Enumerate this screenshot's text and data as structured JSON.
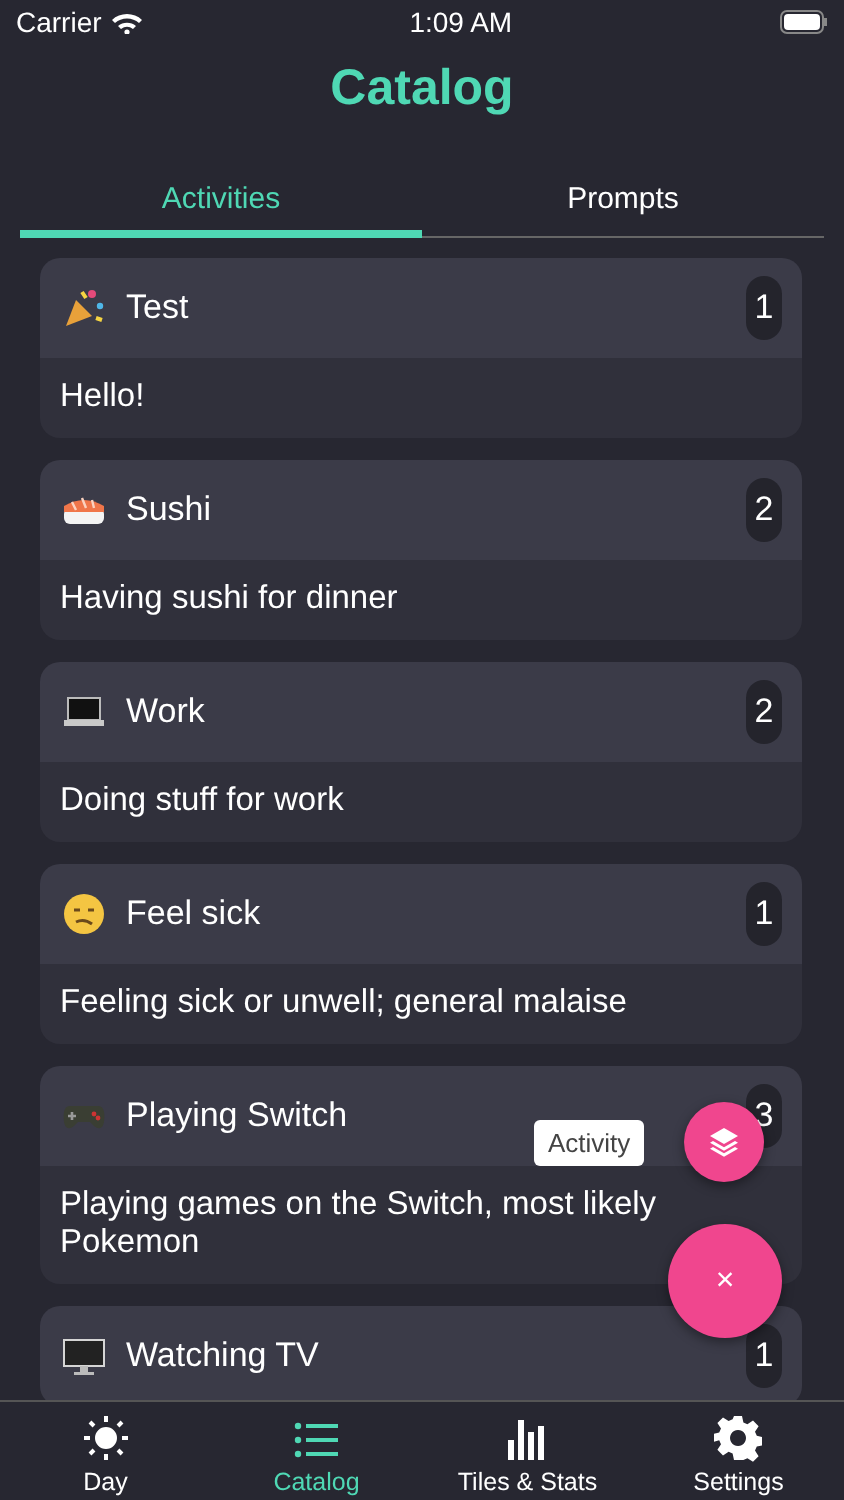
{
  "status_bar": {
    "carrier": "Carrier",
    "time": "1:09 AM"
  },
  "title": "Catalog",
  "tabs": [
    {
      "label": "Activities",
      "selected": true
    },
    {
      "label": "Prompts",
      "selected": false
    }
  ],
  "activities": [
    {
      "name": "Test",
      "count": "1",
      "description": "Hello!"
    },
    {
      "name": "Sushi",
      "count": "2",
      "description": "Having sushi for dinner"
    },
    {
      "name": "Work",
      "count": "2",
      "description": "Doing stuff for work"
    },
    {
      "name": "Feel sick",
      "count": "1",
      "description": "Feeling sick or unwell; general malaise"
    },
    {
      "name": "Playing Switch",
      "count": "3",
      "description": "Playing games on the Switch, most likely Pokemon"
    },
    {
      "name": "Watching TV",
      "count": "1"
    }
  ],
  "fab_menu": {
    "tooltip": "Activity",
    "close": "×"
  },
  "bottom_nav": [
    {
      "label": "Day",
      "selected": false
    },
    {
      "label": "Catalog",
      "selected": true
    },
    {
      "label": "Tiles & Stats",
      "selected": false
    },
    {
      "label": "Settings",
      "selected": false
    }
  ]
}
